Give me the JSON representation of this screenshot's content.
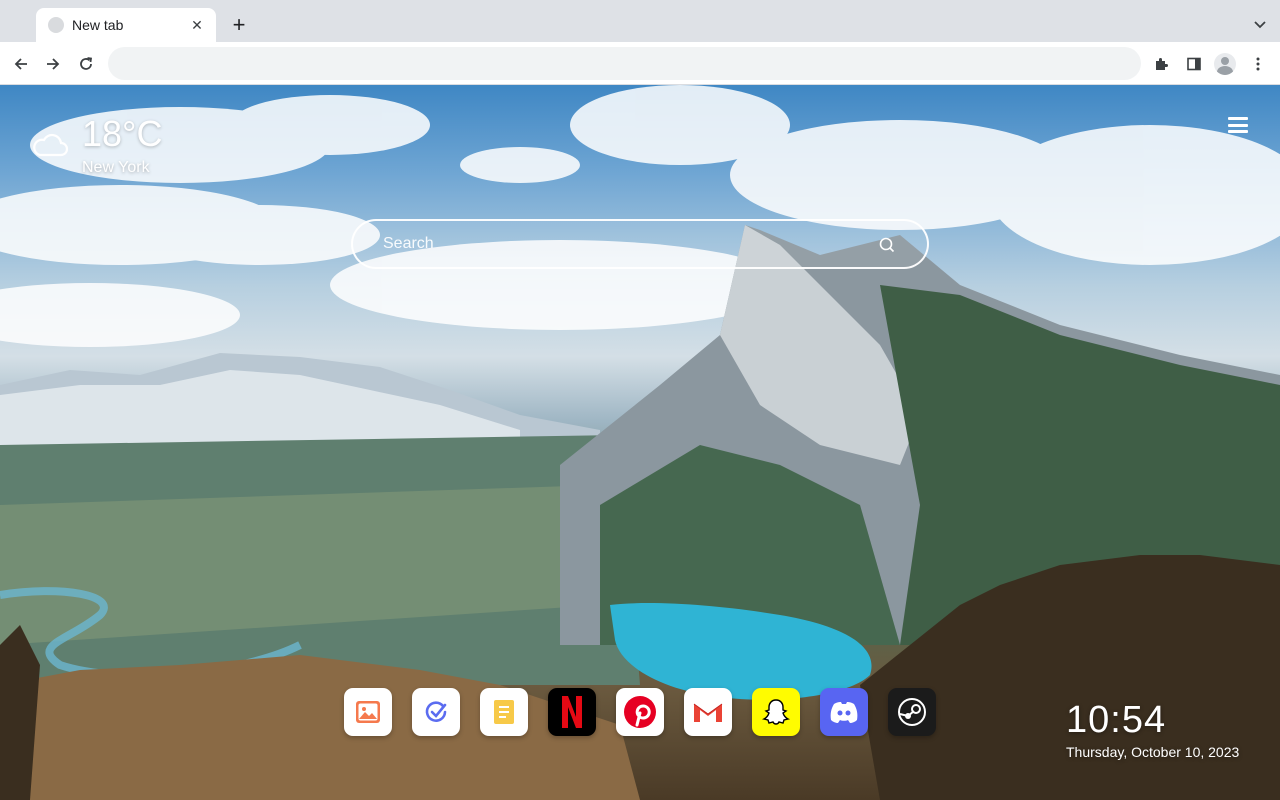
{
  "browser": {
    "tab": {
      "title": "New tab"
    },
    "new_tab_label": "+",
    "close_glyph": "✕",
    "address_bar": {
      "value": "",
      "placeholder": ""
    }
  },
  "weather": {
    "temperature": "18°C",
    "city": "New York",
    "icon": "cloud-icon"
  },
  "search": {
    "placeholder": "Search"
  },
  "apps": [
    {
      "name": "Photos",
      "icon": "photos-icon",
      "color": "#ffffff"
    },
    {
      "name": "Tasks",
      "icon": "tasks-icon",
      "color": "#ffffff"
    },
    {
      "name": "Notes",
      "icon": "notes-icon",
      "color": "#ffffff"
    },
    {
      "name": "Netflix",
      "icon": "netflix-icon",
      "color": "#000000"
    },
    {
      "name": "Pinterest",
      "icon": "pinterest-icon",
      "color": "#ffffff"
    },
    {
      "name": "Gmail",
      "icon": "gmail-icon",
      "color": "#ffffff"
    },
    {
      "name": "Snapchat",
      "icon": "snapchat-icon",
      "color": "#fffc00"
    },
    {
      "name": "Discord",
      "icon": "discord-icon",
      "color": "#5865f2"
    },
    {
      "name": "Steam",
      "icon": "steam-icon",
      "color": "#1b1b1b"
    }
  ],
  "clock": {
    "time": "10:54",
    "date": "Thursday, October 10, 2023"
  }
}
